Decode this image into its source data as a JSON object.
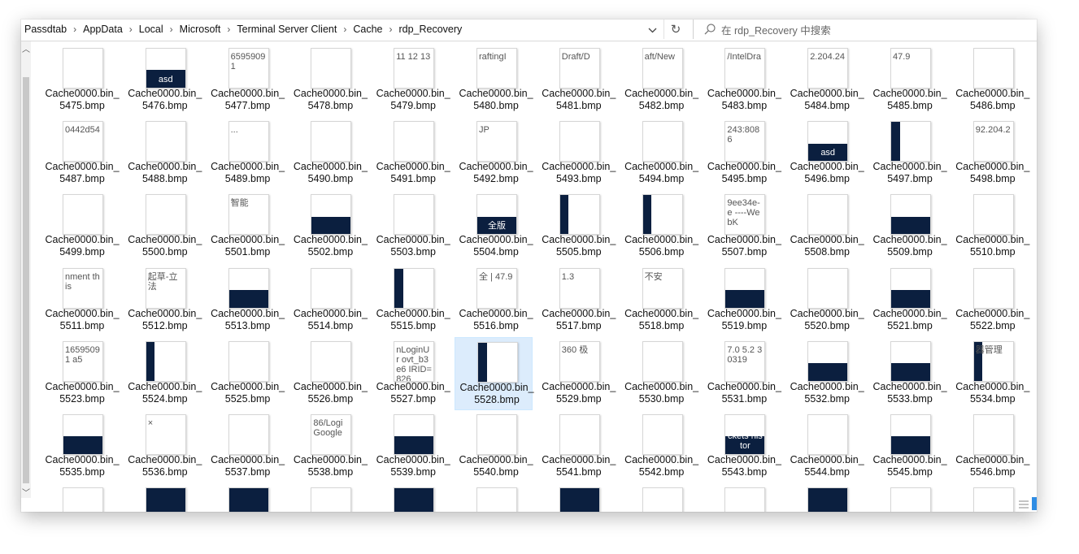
{
  "breadcrumb": [
    "Passdtab",
    "AppData",
    "Local",
    "Microsoft",
    "Terminal Server Client",
    "Cache",
    "rdp_Recovery"
  ],
  "search": {
    "placeholder": "在 rdp_Recovery 中搜索"
  },
  "icons": {
    "dropdown": "chevron-down-icon",
    "refresh": "refresh-icon",
    "search": "search-icon",
    "scroll_up": "scroll-up-icon",
    "scroll_down": "scroll-down-icon"
  },
  "colors": {
    "navy": "#0b1f3f",
    "selection": "#dcecfc",
    "accent": "#3b6fd8"
  },
  "files": [
    {
      "l1": "Cache0000.bin_",
      "l2": "5475.bmp",
      "snip": ""
    },
    {
      "l1": "Cache0000.bin_",
      "l2": "5476.bmp",
      "snip": "asd"
    },
    {
      "l1": "Cache0000.bin_",
      "l2": "5477.bmp",
      "snip": "65959091"
    },
    {
      "l1": "Cache0000.bin_",
      "l2": "5478.bmp",
      "snip": ""
    },
    {
      "l1": "Cache0000.bin_",
      "l2": "5479.bmp",
      "snip": "11 12 13"
    },
    {
      "l1": "Cache0000.bin_",
      "l2": "5480.bmp",
      "snip": "raftingI"
    },
    {
      "l1": "Cache0000.bin_",
      "l2": "5481.bmp",
      "snip": "Draft/D"
    },
    {
      "l1": "Cache0000.bin_",
      "l2": "5482.bmp",
      "snip": "aft/New"
    },
    {
      "l1": "Cache0000.bin_",
      "l2": "5483.bmp",
      "snip": "/IntelDra"
    },
    {
      "l1": "Cache0000.bin_",
      "l2": "5484.bmp",
      "snip": "2.204.24"
    },
    {
      "l1": "Cache0000.bin_",
      "l2": "5485.bmp",
      "snip": "47.9"
    },
    {
      "l1": "Cache0000.bin_",
      "l2": "5486.bmp",
      "snip": ""
    },
    {
      "l1": "Cache0000.bin_",
      "l2": "5487.bmp",
      "snip": "0442d54"
    },
    {
      "l1": "Cache0000.bin_",
      "l2": "5488.bmp",
      "snip": ""
    },
    {
      "l1": "Cache0000.bin_",
      "l2": "5489.bmp",
      "snip": "..."
    },
    {
      "l1": "Cache0000.bin_",
      "l2": "5490.bmp",
      "snip": ""
    },
    {
      "l1": "Cache0000.bin_",
      "l2": "5491.bmp",
      "snip": ""
    },
    {
      "l1": "Cache0000.bin_",
      "l2": "5492.bmp",
      "snip": "JP"
    },
    {
      "l1": "Cache0000.bin_",
      "l2": "5493.bmp",
      "snip": ""
    },
    {
      "l1": "Cache0000.bin_",
      "l2": "5494.bmp",
      "snip": ""
    },
    {
      "l1": "Cache0000.bin_",
      "l2": "5495.bmp",
      "snip": "243:8086"
    },
    {
      "l1": "Cache0000.bin_",
      "l2": "5496.bmp",
      "snip": "asd"
    },
    {
      "l1": "Cache0000.bin_",
      "l2": "5497.bmp",
      "snip": ""
    },
    {
      "l1": "Cache0000.bin_",
      "l2": "5498.bmp",
      "snip": "92.204.2"
    },
    {
      "l1": "Cache0000.bin_",
      "l2": "5499.bmp",
      "snip": ""
    },
    {
      "l1": "Cache0000.bin_",
      "l2": "5500.bmp",
      "snip": ""
    },
    {
      "l1": "Cache0000.bin_",
      "l2": "5501.bmp",
      "snip": "智能"
    },
    {
      "l1": "Cache0000.bin_",
      "l2": "5502.bmp",
      "snip": ""
    },
    {
      "l1": "Cache0000.bin_",
      "l2": "5503.bmp",
      "snip": ""
    },
    {
      "l1": "Cache0000.bin_",
      "l2": "5504.bmp",
      "snip": "全版"
    },
    {
      "l1": "Cache0000.bin_",
      "l2": "5505.bmp",
      "snip": ""
    },
    {
      "l1": "Cache0000.bin_",
      "l2": "5506.bmp",
      "snip": ""
    },
    {
      "l1": "Cache0000.bin_",
      "l2": "5507.bmp",
      "snip": "9ee34e-e ----WebK"
    },
    {
      "l1": "Cache0000.bin_",
      "l2": "5508.bmp",
      "snip": ""
    },
    {
      "l1": "Cache0000.bin_",
      "l2": "5509.bmp",
      "snip": ""
    },
    {
      "l1": "Cache0000.bin_",
      "l2": "5510.bmp",
      "snip": ""
    },
    {
      "l1": "Cache0000.bin_",
      "l2": "5511.bmp",
      "snip": "nment this"
    },
    {
      "l1": "Cache0000.bin_",
      "l2": "5512.bmp",
      "snip": "起草-立法"
    },
    {
      "l1": "Cache0000.bin_",
      "l2": "5513.bmp",
      "snip": ""
    },
    {
      "l1": "Cache0000.bin_",
      "l2": "5514.bmp",
      "snip": ""
    },
    {
      "l1": "Cache0000.bin_",
      "l2": "5515.bmp",
      "snip": ""
    },
    {
      "l1": "Cache0000.bin_",
      "l2": "5516.bmp",
      "snip": "全 | 47.9"
    },
    {
      "l1": "Cache0000.bin_",
      "l2": "5517.bmp",
      "snip": "1.3"
    },
    {
      "l1": "Cache0000.bin_",
      "l2": "5518.bmp",
      "snip": "不安"
    },
    {
      "l1": "Cache0000.bin_",
      "l2": "5519.bmp",
      "snip": ""
    },
    {
      "l1": "Cache0000.bin_",
      "l2": "5520.bmp",
      "snip": ""
    },
    {
      "l1": "Cache0000.bin_",
      "l2": "5521.bmp",
      "snip": ""
    },
    {
      "l1": "Cache0000.bin_",
      "l2": "5522.bmp",
      "snip": ""
    },
    {
      "l1": "Cache0000.bin_",
      "l2": "5523.bmp",
      "snip": "16595091 a5"
    },
    {
      "l1": "Cache0000.bin_",
      "l2": "5524.bmp",
      "snip": ""
    },
    {
      "l1": "Cache0000.bin_",
      "l2": "5525.bmp",
      "snip": ""
    },
    {
      "l1": "Cache0000.bin_",
      "l2": "5526.bmp",
      "snip": ""
    },
    {
      "l1": "Cache0000.bin_",
      "l2": "5527.bmp",
      "snip": "nLoginUr ovt_b3e6 IRID=826"
    },
    {
      "l1": "Cache0000.bin_",
      "l2": "5528.bmp",
      "snip": ""
    },
    {
      "l1": "Cache0000.bin_",
      "l2": "5529.bmp",
      "snip": "360 极"
    },
    {
      "l1": "Cache0000.bin_",
      "l2": "5530.bmp",
      "snip": ""
    },
    {
      "l1": "Cache0000.bin_",
      "l2": "5531.bmp",
      "snip": "7.0 5.2 30319"
    },
    {
      "l1": "Cache0000.bin_",
      "l2": "5532.bmp",
      "snip": ""
    },
    {
      "l1": "Cache0000.bin_",
      "l2": "5533.bmp",
      "snip": ""
    },
    {
      "l1": "Cache0000.bin_",
      "l2": "5534.bmp",
      "snip": "器管理"
    },
    {
      "l1": "Cache0000.bin_",
      "l2": "5535.bmp",
      "snip": ""
    },
    {
      "l1": "Cache0000.bin_",
      "l2": "5536.bmp",
      "snip": "×"
    },
    {
      "l1": "Cache0000.bin_",
      "l2": "5537.bmp",
      "snip": ""
    },
    {
      "l1": "Cache0000.bin_",
      "l2": "5538.bmp",
      "snip": "86/Logi Google"
    },
    {
      "l1": "Cache0000.bin_",
      "l2": "5539.bmp",
      "snip": ""
    },
    {
      "l1": "Cache0000.bin_",
      "l2": "5540.bmp",
      "snip": ""
    },
    {
      "l1": "Cache0000.bin_",
      "l2": "5541.bmp",
      "snip": ""
    },
    {
      "l1": "Cache0000.bin_",
      "l2": "5542.bmp",
      "snip": ""
    },
    {
      "l1": "Cache0000.bin_",
      "l2": "5543.bmp",
      "snip": "ckets histor"
    },
    {
      "l1": "Cache0000.bin_",
      "l2": "5544.bmp",
      "snip": ""
    },
    {
      "l1": "Cache0000.bin_",
      "l2": "5545.bmp",
      "snip": ""
    },
    {
      "l1": "Cache0000.bin_",
      "l2": "5546.bmp",
      "snip": ""
    }
  ],
  "selected_file": "5528.bmp"
}
